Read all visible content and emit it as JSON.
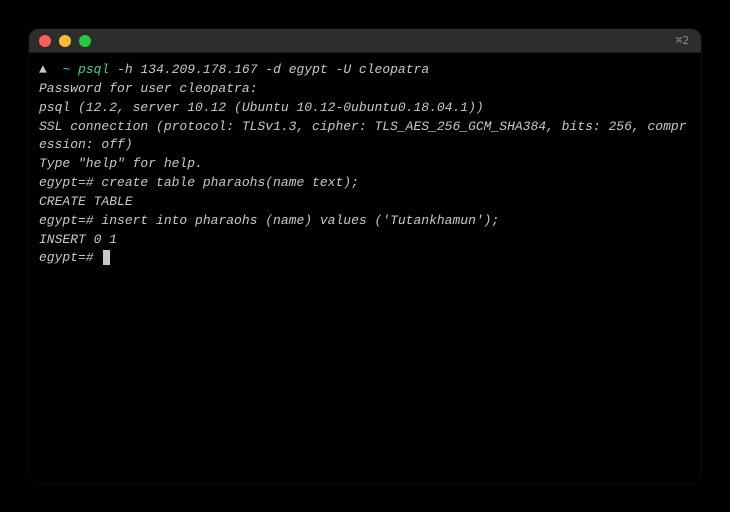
{
  "titlebar": {
    "session_label": "⌘2"
  },
  "prompt": {
    "triangle": "▲",
    "tilde": "~",
    "command": "psql",
    "args": "-h 134.209.178.167 -d egypt -U cleopatra"
  },
  "lines": {
    "password_prompt": "Password for user cleopatra:",
    "version": "psql (12.2, server 10.12 (Ubuntu 10.12-0ubuntu0.18.04.1))",
    "ssl": "SSL connection (protocol: TLSv1.3, cipher: TLS_AES_256_GCM_SHA384, bits: 256, compression: off)",
    "help": "Type \"help\" for help.",
    "blank": "",
    "stmt1_prompt": "egypt=# ",
    "stmt1_sql": "create table pharaohs(name text);",
    "stmt1_result": "CREATE TABLE",
    "stmt2_prompt": "egypt=# ",
    "stmt2_sql": "insert into pharaohs (name) values ('Tutankhamun');",
    "stmt2_result": "INSERT 0 1",
    "stmt3_prompt": "egypt=# "
  }
}
